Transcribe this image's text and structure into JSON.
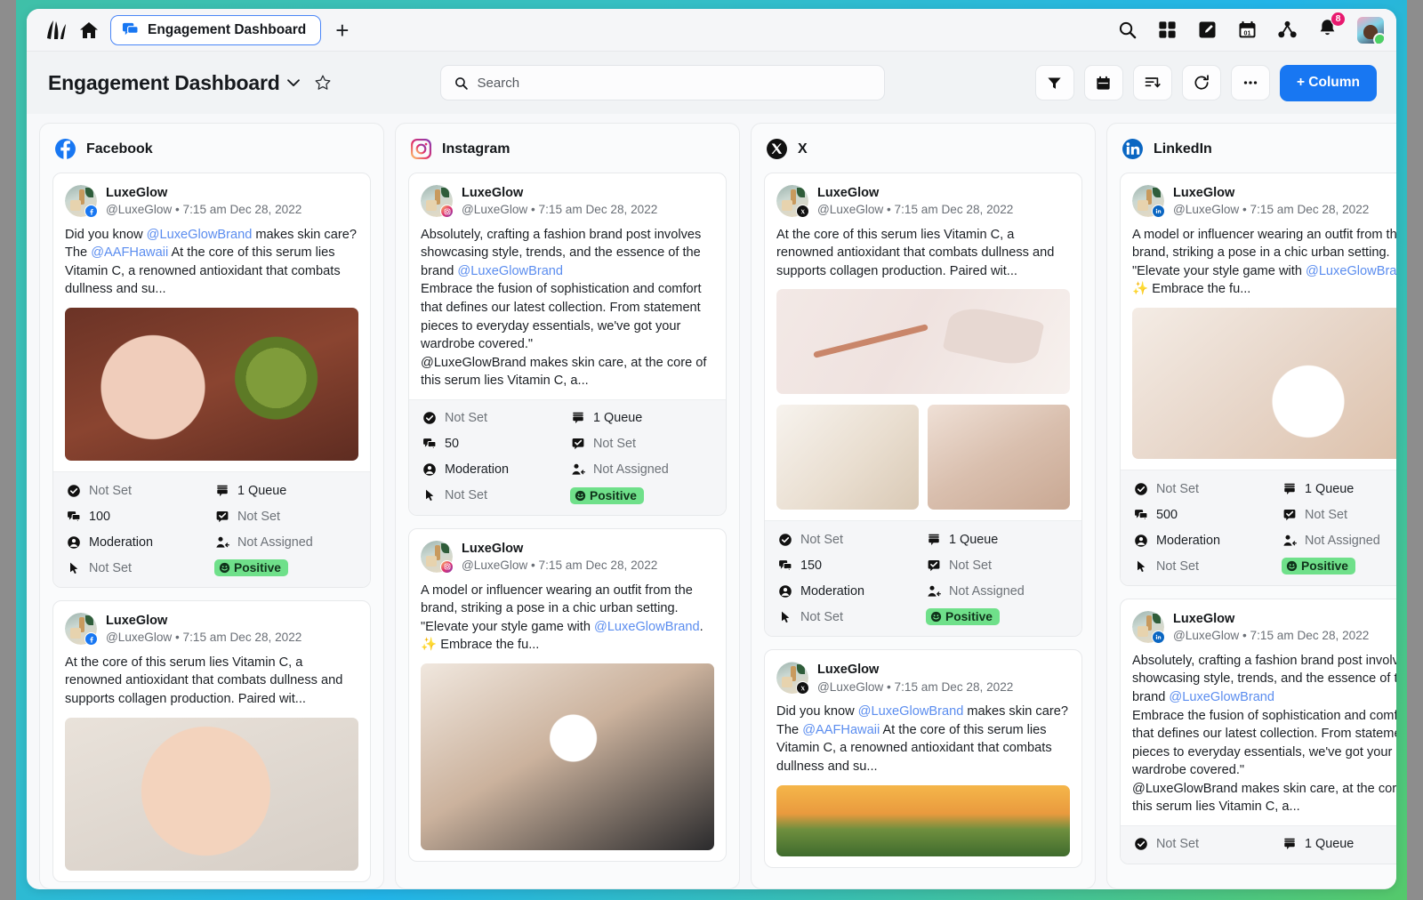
{
  "topbar": {
    "logo_name": "app-logo",
    "home_icon": "home-icon",
    "tab": {
      "label": "Engagement Dashboard",
      "icon": "chat-bubble-icon"
    },
    "new_tab_label": "+",
    "icons": [
      {
        "name": "search-icon"
      },
      {
        "name": "grid-apps-icon"
      },
      {
        "name": "compose-edit-icon"
      },
      {
        "name": "calendar-icon",
        "label": "01"
      },
      {
        "name": "network-share-icon"
      },
      {
        "name": "bell-notifications-icon",
        "badge": "8"
      }
    ],
    "avatar": "user-avatar"
  },
  "toolbar": {
    "title": "Engagement Dashboard",
    "chevron_icon": "chevron-down-icon",
    "star_icon": "star-outline-icon",
    "search": {
      "placeholder": "Search",
      "value": "",
      "icon": "search-icon"
    },
    "buttons": [
      {
        "name": "filter-button",
        "icon": "filter-funnel-icon"
      },
      {
        "name": "calendar-button",
        "icon": "calendar-icon"
      },
      {
        "name": "sort-button",
        "icon": "sort-descending-icon"
      },
      {
        "name": "refresh-button",
        "icon": "refresh-icon"
      },
      {
        "name": "more-options-button",
        "icon": "ellipsis-icon"
      }
    ],
    "add_column_label": "+ Column"
  },
  "post": {
    "author": "LuxeGlow",
    "handle": "@LuxeGlow",
    "separator": "•",
    "timestamp": "7:15 am Dec 28, 2022"
  },
  "meta_labels": {
    "status_icon": "check-circle-icon",
    "queue_icon": "queue-stack-icon",
    "comments_icon": "comments-icon",
    "task_icon": "checkbox-bubble-icon",
    "moderation_icon": "person-circle-icon",
    "assign_icon": "assign-person-icon",
    "pointer_icon": "cursor-pointer-icon",
    "sentiment_icon": "smiley-icon"
  },
  "columns": [
    {
      "name": "Facebook",
      "icon": "facebook-icon",
      "posts": [
        {
          "text_parts": [
            {
              "t": "Did you know "
            },
            {
              "t": "@LuxeGlowBrand",
              "mention": true
            },
            {
              "t": " makes skin care? The "
            },
            {
              "t": "@AAFHawaii",
              "mention": true
            },
            {
              "t": " At the core of this serum lies Vitamin C, a renowned antioxidant that combats dullness and su..."
            }
          ],
          "media": [
            {
              "kind": "img-avocado"
            }
          ],
          "meta": {
            "status": "Not Set",
            "queue": "1 Queue",
            "comments": "100",
            "task": "Not Set",
            "moderation": "Moderation",
            "assignee": "Not Assigned",
            "pointer": "Not Set",
            "sentiment": "Positive"
          }
        },
        {
          "text_parts": [
            {
              "t": "At the core of this serum lies Vitamin C, a renowned antioxidant that combats dullness and supports collagen production. Paired wit..."
            }
          ],
          "media": [
            {
              "kind": "img-face2"
            }
          ],
          "meta": null
        }
      ]
    },
    {
      "name": "Instagram",
      "icon": "instagram-icon",
      "posts": [
        {
          "text_parts": [
            {
              "t": "Absolutely, crafting a fashion brand post involves showcasing style, trends, and the essence of the brand "
            },
            {
              "t": "@LuxeGlowBrand",
              "mention": true
            },
            {
              "t": "\nEmbrace the fusion of sophistication and comfort that defines our latest collection. From statement pieces to everyday essentials, we've got your wardrobe covered.\"\n@LuxeGlowBrand makes skin care, at the core of this serum lies Vitamin C, a..."
            }
          ],
          "media": [],
          "meta": {
            "status": "Not Set",
            "queue": "1 Queue",
            "comments": "50",
            "task": "Not Set",
            "moderation": "Moderation",
            "assignee": "Not Assigned",
            "pointer": "Not Set",
            "sentiment": "Positive"
          }
        },
        {
          "text_parts": [
            {
              "t": "A model or influencer wearing an outfit from the brand, striking a pose in a chic urban setting. \"Elevate your style game with "
            },
            {
              "t": "@LuxeGlowBrand",
              "mention": true
            },
            {
              "t": ". ✨ Embrace the fu..."
            }
          ],
          "media": [
            {
              "kind": "img-hands"
            }
          ],
          "meta": null
        }
      ]
    },
    {
      "name": "X",
      "icon": "x-icon",
      "posts": [
        {
          "text_parts": [
            {
              "t": "At the core of this serum lies Vitamin C, a renowned antioxidant that combats dullness and supports collagen production. Paired wit..."
            }
          ],
          "media": [
            {
              "kind": "img-roller"
            }
          ],
          "media_row": [
            {
              "kind": "img-cream"
            },
            {
              "kind": "img-dropper"
            }
          ],
          "meta": {
            "status": "Not Set",
            "queue": "1 Queue",
            "comments": "150",
            "task": "Not Set",
            "moderation": "Moderation",
            "assignee": "Not Assigned",
            "pointer": "Not Set",
            "sentiment": "Positive"
          }
        },
        {
          "text_parts": [
            {
              "t": "Did you know "
            },
            {
              "t": "@LuxeGlowBrand",
              "mention": true
            },
            {
              "t": " makes skin care? The "
            },
            {
              "t": "@AAFHawaii",
              "mention": true
            },
            {
              "t": " At the core of this serum lies Vitamin C, a renowned antioxidant that combats dullness and su..."
            }
          ],
          "media": [
            {
              "kind": "img-sunset"
            }
          ],
          "meta": null
        }
      ]
    },
    {
      "name": "LinkedIn",
      "icon": "linkedin-icon",
      "posts": [
        {
          "text_parts": [
            {
              "t": "A model or influencer wearing an outfit from the brand, striking a pose in a chic urban setting. \"Elevate your style game with "
            },
            {
              "t": "@LuxeGlowBrand",
              "mention": true
            },
            {
              "t": ". ✨ Embrace the fu..."
            }
          ],
          "media": [
            {
              "kind": "img-foam"
            }
          ],
          "meta": {
            "status": "Not Set",
            "queue": "1 Queue",
            "comments": "500",
            "task": "Not Set",
            "moderation": "Moderation",
            "assignee": "Not Assigned",
            "pointer": "Not Set",
            "sentiment": "Positive"
          }
        },
        {
          "text_parts": [
            {
              "t": "Absolutely, crafting a fashion brand post involves showcasing style, trends, and the essence of the brand "
            },
            {
              "t": "@LuxeGlowBrand",
              "mention": true
            },
            {
              "t": "\nEmbrace the fusion of sophistication and comfort that defines our latest collection. From statement pieces to everyday essentials, we've got your wardrobe covered.\"\n@LuxeGlowBrand makes skin care, at the core of this serum lies Vitamin C, a..."
            }
          ],
          "media": [],
          "meta_partial": {
            "status": "Not Set",
            "queue": "1 Queue"
          }
        }
      ]
    }
  ],
  "colors": {
    "accent_blue": "#1877f2",
    "mention_blue": "#5b8def",
    "sentiment_green": "#6fe08a",
    "badge_pink": "#e8196f",
    "frame_teal": "#3fc0a8",
    "frame_cyan": "#22b4e8",
    "frame_green": "#55c96b"
  }
}
